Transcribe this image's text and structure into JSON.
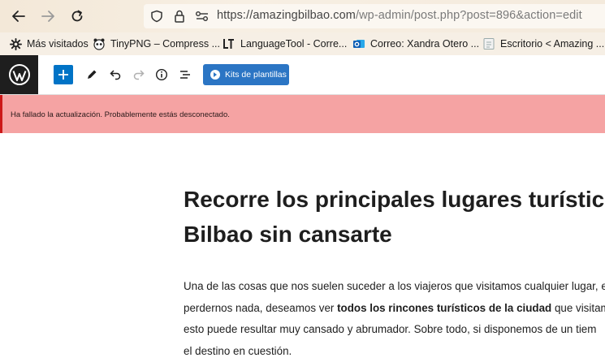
{
  "browser": {
    "url_host": "https://amazingbilbao.com",
    "url_path": "/wp-admin/post.php?post=896&action=edit"
  },
  "bookmarks": [
    {
      "label": "Más visitados",
      "icon": "gear-icon"
    },
    {
      "label": "TinyPNG – Compress ...",
      "icon": "panda-icon"
    },
    {
      "label": "LanguageTool - Corre...",
      "icon": "languagetool-icon"
    },
    {
      "label": "Correo: Xandra Otero ...",
      "icon": "outlook-icon"
    },
    {
      "label": "Escritorio < Amazing ...",
      "icon": "page-icon"
    }
  ],
  "toolbar": {
    "kits_label": "Kits de plantillas"
  },
  "notice": {
    "text": "Ha fallado la actualización. Probablemente estás desconectado."
  },
  "post": {
    "title_line1": "Recorre los principales lugares turístico",
    "title_line2": "Bilbao sin cansarte",
    "para_line1": "Una de las cosas que nos suelen suceder a los viajeros que visitamos cualquier lugar, e",
    "para_line2_a": "perdernos nada, deseamos ver ",
    "para_line2_b": "todos los rincones turísticos de la ciudad",
    "para_line2_c": " que visitam",
    "para_line3": "esto puede resultar muy cansado y abrumador. Sobre todo, si disponemos de un tiem",
    "para_line4": "el destino en cuestión."
  },
  "colors": {
    "wp_blue": "#0073c6",
    "notice_bg": "#f5a3a3",
    "notice_border": "#cc1818"
  }
}
